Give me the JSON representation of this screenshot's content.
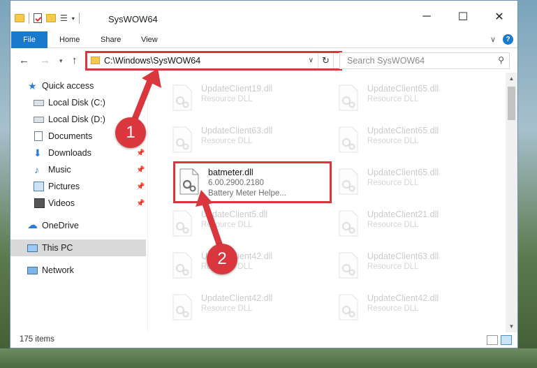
{
  "window": {
    "title": "SysWOW64",
    "controls": {
      "minimize": "─",
      "maximize": "☐",
      "close": "✕"
    }
  },
  "ribbon": {
    "tabs": [
      "File",
      "Home",
      "Share",
      "View"
    ],
    "collapse_icon": "chevron-down-icon",
    "help": "?"
  },
  "address": {
    "path": "C:\\Windows\\SysWOW64",
    "search_placeholder": "Search SysWOW64"
  },
  "nav": {
    "items": [
      {
        "label": "Quick access",
        "icon": "star-icon",
        "pinned": false
      },
      {
        "label": "Local Disk (C:)",
        "icon": "disk-icon",
        "pinned": false
      },
      {
        "label": "Local Disk (D:)",
        "icon": "disk-icon",
        "pinned": false
      },
      {
        "label": "Documents",
        "icon": "documents-icon",
        "pinned": false
      },
      {
        "label": "Downloads",
        "icon": "downloads-icon",
        "pinned": true
      },
      {
        "label": "Music",
        "icon": "music-icon",
        "pinned": true
      },
      {
        "label": "Pictures",
        "icon": "pictures-icon",
        "pinned": true
      },
      {
        "label": "Videos",
        "icon": "videos-icon",
        "pinned": true
      },
      {
        "label": "OneDrive",
        "icon": "onedrive-icon",
        "pinned": false
      },
      {
        "label": "This PC",
        "icon": "pc-icon",
        "pinned": false,
        "selected": true
      },
      {
        "label": "Network",
        "icon": "network-icon",
        "pinned": false
      }
    ]
  },
  "files": {
    "left": [
      {
        "name": "UpdateClient19.dll",
        "type": "Resource DLL"
      },
      {
        "name": "UpdateClient63.dll",
        "type": "Resource DLL"
      },
      {
        "name": "batmeter.dll",
        "type": "6.00.2900.2180",
        "desc": "Battery Meter Helpe..."
      },
      {
        "name": "UpdateClient5.dll",
        "type": "Resource DLL"
      },
      {
        "name": "UpdateClient42.dll",
        "type": "Resource DLL"
      },
      {
        "name": "UpdateClient42.dll",
        "type": "Resource DLL"
      }
    ],
    "right": [
      {
        "name": "UpdateClient65.dll",
        "type": "Resource DLL"
      },
      {
        "name": "UpdateClient65.dll",
        "type": "Resource DLL"
      },
      {
        "name": "UpdateClient65.dll",
        "type": "Resource DLL"
      },
      {
        "name": "UpdateClient21.dll",
        "type": "Resource DLL"
      },
      {
        "name": "UpdateClient63.dll",
        "type": "Resource DLL"
      },
      {
        "name": "UpdateClient42.dll",
        "type": "Resource DLL"
      }
    ]
  },
  "status": {
    "count": "175 items"
  },
  "callouts": {
    "step1": "1",
    "step2": "2",
    "color": "#d9363e"
  }
}
